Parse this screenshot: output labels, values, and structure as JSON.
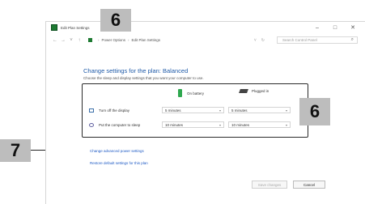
{
  "window": {
    "title": "Edit Plan Settings",
    "controls": [
      "–",
      "□",
      "✕"
    ]
  },
  "addressbar": {
    "nav": [
      "←",
      "→",
      "˅",
      "↑"
    ],
    "crumbs": [
      "Power Options",
      "Edit Plan Settings"
    ],
    "refresh_glyph": "↻",
    "dropdown_glyph": "˅",
    "search_placeholder": "Search Control Panel",
    "search_glyph": "⌕"
  },
  "main": {
    "heading": "Change settings for the plan: Balanced",
    "subheading": "Choose the sleep and display settings that you want your computer to use.",
    "columns": {
      "battery": "On battery",
      "plugged": "Plugged in"
    },
    "rows": [
      {
        "label": "Turn off the display",
        "battery": "5 minutes",
        "plugged": "5 minutes"
      },
      {
        "label": "Put the computer to sleep",
        "battery": "10 minutes",
        "plugged": "10 minutes"
      }
    ],
    "links": {
      "advanced": "Change advanced power settings",
      "restore": "Restore default settings for this plan"
    },
    "buttons": {
      "save": "Save changes",
      "cancel": "Cancel"
    }
  },
  "callouts": {
    "top": "6",
    "box": "6",
    "left": "7"
  },
  "colors": {
    "heading": "#1e5aa8",
    "link": "#1f5bc5",
    "callout_bg": "#bdbdbd"
  }
}
